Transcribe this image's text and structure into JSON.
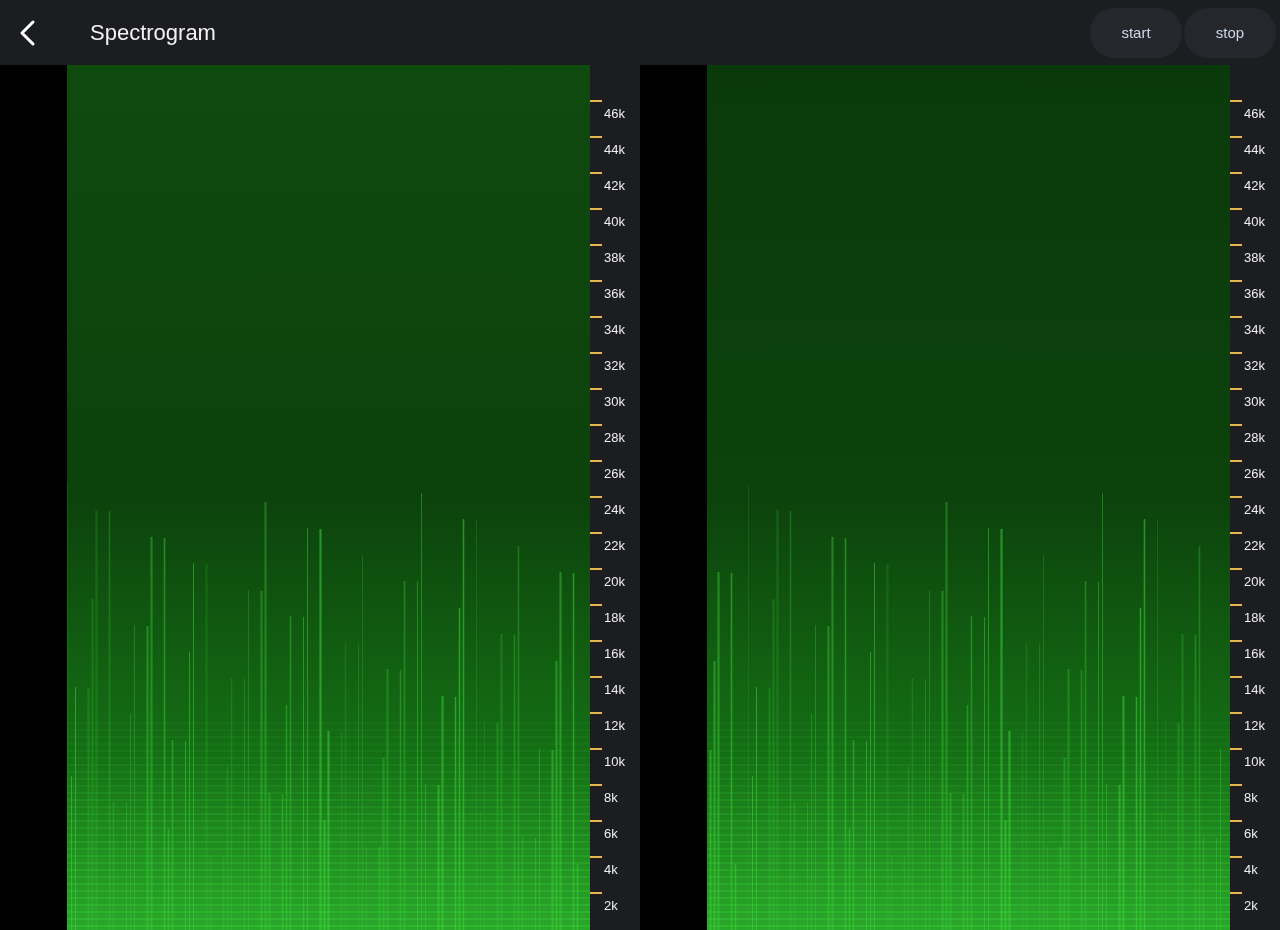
{
  "header": {
    "title": "Spectrogram",
    "buttons": [
      "start",
      "stop"
    ]
  },
  "panels": [
    {
      "axis_labels": [
        "46k",
        "44k",
        "42k",
        "40k",
        "38k",
        "36k",
        "34k",
        "32k",
        "30k",
        "28k",
        "26k",
        "24k",
        "22k",
        "20k",
        "18k",
        "16k",
        "14k",
        "12k",
        "10k",
        "8k",
        "6k",
        "4k",
        "2k"
      ]
    },
    {
      "axis_labels": [
        "46k",
        "44k",
        "42k",
        "40k",
        "38k",
        "36k",
        "34k",
        "32k",
        "30k",
        "28k",
        "26k",
        "24k",
        "22k",
        "20k",
        "18k",
        "16k",
        "14k",
        "12k",
        "10k",
        "8k",
        "6k",
        "4k",
        "2k"
      ]
    }
  ]
}
